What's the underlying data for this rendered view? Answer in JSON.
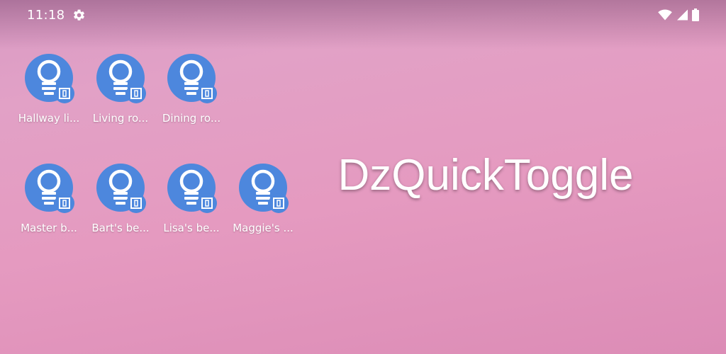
{
  "status_bar": {
    "time": "11:18",
    "icons": [
      "settings-icon",
      "wifi-icon",
      "signal-icon",
      "battery-icon"
    ]
  },
  "shortcuts": [
    {
      "label": "Hallway li...",
      "icon": "lightbulb-icon"
    },
    {
      "label": "Living ro...",
      "icon": "lightbulb-icon"
    },
    {
      "label": "Dining ro...",
      "icon": "lightbulb-icon"
    },
    {
      "label": "Master b...",
      "icon": "lightbulb-icon"
    },
    {
      "label": "Bart's be...",
      "icon": "lightbulb-icon"
    },
    {
      "label": "Lisa's be...",
      "icon": "lightbulb-icon"
    },
    {
      "label": "Maggie's ...",
      "icon": "lightbulb-icon"
    }
  ],
  "widget": {
    "title": "DzQuickToggle"
  },
  "colors": {
    "icon_blue": "#4d87dd",
    "background_pink": "#e29ac2",
    "text": "#ffffff"
  }
}
